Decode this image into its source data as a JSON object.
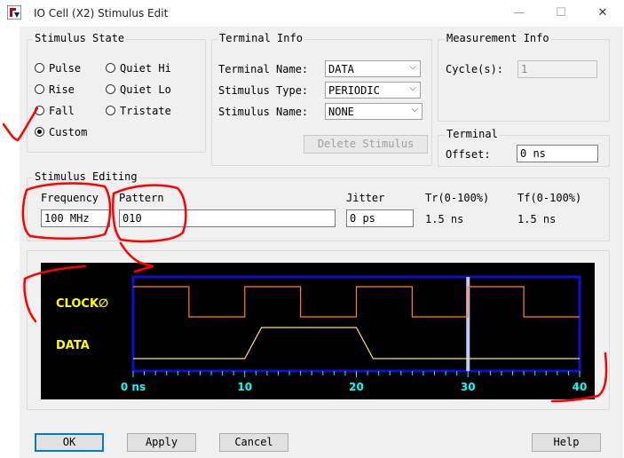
{
  "window": {
    "title": "IO Cell (X2) Stimulus Edit",
    "minimize": "—",
    "maximize": "☐",
    "close": "✕"
  },
  "stimulus_state": {
    "title": "Stimulus State",
    "options": [
      "Pulse",
      "Quiet Hi",
      "Rise",
      "Quiet Lo",
      "Fall",
      "Tristate",
      "Custom"
    ],
    "selected": "Custom"
  },
  "terminal_info": {
    "title": "Terminal Info",
    "name_label": "Terminal Name:",
    "name_value": "DATA",
    "type_label": "Stimulus Type:",
    "type_value": "PERIODIC",
    "stim_label": "Stimulus Name:",
    "stim_value": "NONE",
    "delete_button": "Delete Stimulus"
  },
  "measurement_info": {
    "title": "Measurement Info",
    "cycles_label": "Cycle(s):",
    "cycles_value": "1"
  },
  "terminal": {
    "title": "Terminal",
    "offset_label": "Offset:",
    "offset_value": "0 ns"
  },
  "stimulus_editing": {
    "title": "Stimulus Editing",
    "frequency_label": "Frequency",
    "frequency_value": "100 MHz",
    "pattern_label": "Pattern",
    "pattern_value": "010",
    "jitter_label": "Jitter",
    "jitter_value": "0 ps",
    "tr_label": "Tr(0-100%)",
    "tr_value": "1.5 ns",
    "tf_label": "Tf(0-100%)",
    "tf_value": "1.5 ns"
  },
  "waveform": {
    "signals": [
      "CLOCK∅",
      "DATA"
    ],
    "axis_ticks": [
      "0 ns",
      "10",
      "20",
      "30",
      "40"
    ],
    "time_range_ns": [
      0,
      40
    ],
    "clock_period_ns": 10,
    "cursor_ns": 30,
    "data_pattern": "010",
    "colors": {
      "frame": "#1010d0",
      "clock": "#ff7f27",
      "data": "#ffe066",
      "labels": "#ffff00",
      "ticks": "#00ffff",
      "cursor": "#c8c8ff"
    }
  },
  "buttons": {
    "ok": "OK",
    "apply": "Apply",
    "cancel": "Cancel",
    "help": "Help"
  }
}
